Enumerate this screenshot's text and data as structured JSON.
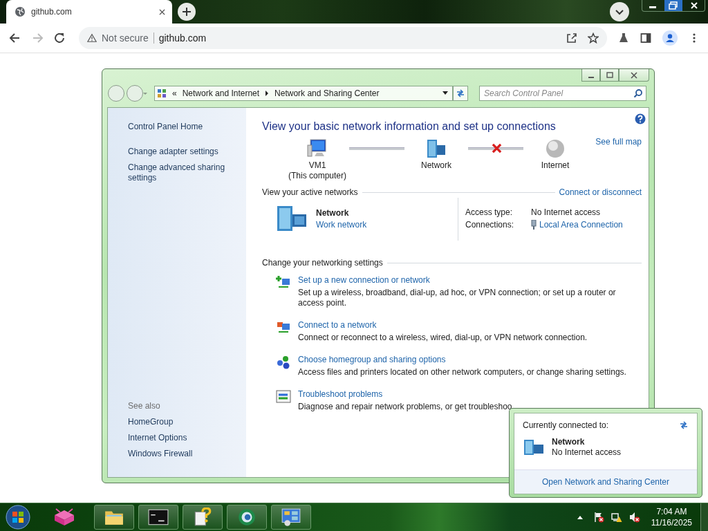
{
  "browser": {
    "tab": {
      "title": "github.com"
    },
    "security": "Not secure",
    "url": "github.com"
  },
  "window": {
    "breadcrumb_marker": "«",
    "breadcrumb": [
      "Network and Internet",
      "Network and Sharing Center"
    ],
    "search": {
      "placeholder": "Search Control Panel"
    }
  },
  "sidebar": {
    "items": [
      "Control Panel Home",
      "Change adapter settings",
      "Change advanced sharing settings"
    ],
    "see_also": "See also",
    "see_also_items": [
      "HomeGroup",
      "Internet Options",
      "Windows Firewall"
    ]
  },
  "main": {
    "title": "View your basic network information and set up connections",
    "see_full_map": "See full map",
    "map_nodes": [
      {
        "label": "VM1",
        "sublabel": "(This computer)",
        "kind": "computer"
      },
      {
        "label": "Network",
        "kind": "network"
      },
      {
        "label": "Internet",
        "kind": "internet"
      }
    ],
    "map_links": [
      {
        "broken": false
      },
      {
        "broken": true
      }
    ],
    "active_networks": {
      "heading": "View your active networks",
      "action": "Connect or disconnect",
      "name": "Network",
      "type": "Work network",
      "access_label": "Access type:",
      "access_value": "No Internet access",
      "connections_label": "Connections:",
      "connections_value": "Local Area Connection"
    },
    "settings_heading": "Change your networking settings",
    "tasks": [
      {
        "kind": "new",
        "title": "Set up a new connection or network",
        "description": "Set up a wireless, broadband, dial-up, ad hoc, or VPN connection; or set up a router or access point."
      },
      {
        "kind": "connect",
        "title": "Connect to a network",
        "description": "Connect or reconnect to a wireless, wired, dial-up, or VPN network connection."
      },
      {
        "kind": "homegroup",
        "title": "Choose homegroup and sharing options",
        "description": "Access files and printers located on other network computers, or change sharing settings."
      },
      {
        "kind": "troubleshoot",
        "title": "Troubleshoot problems",
        "description": "Diagnose and repair network problems, or get troubleshoo"
      }
    ]
  },
  "popup": {
    "heading": "Currently connected to:",
    "network": "Network",
    "status": "No Internet access",
    "link": "Open Network and Sharing Center"
  },
  "taskbar": {
    "apps": [
      {
        "kind": "cube"
      },
      {
        "kind": "folder"
      },
      {
        "kind": "terminal"
      },
      {
        "kind": "help"
      },
      {
        "kind": "globe"
      },
      {
        "kind": "panel"
      }
    ],
    "tray": [
      {
        "kind": "flag"
      },
      {
        "kind": "network"
      },
      {
        "kind": "volume"
      }
    ],
    "time": "7:04 AM",
    "date": "11/16/2025"
  }
}
